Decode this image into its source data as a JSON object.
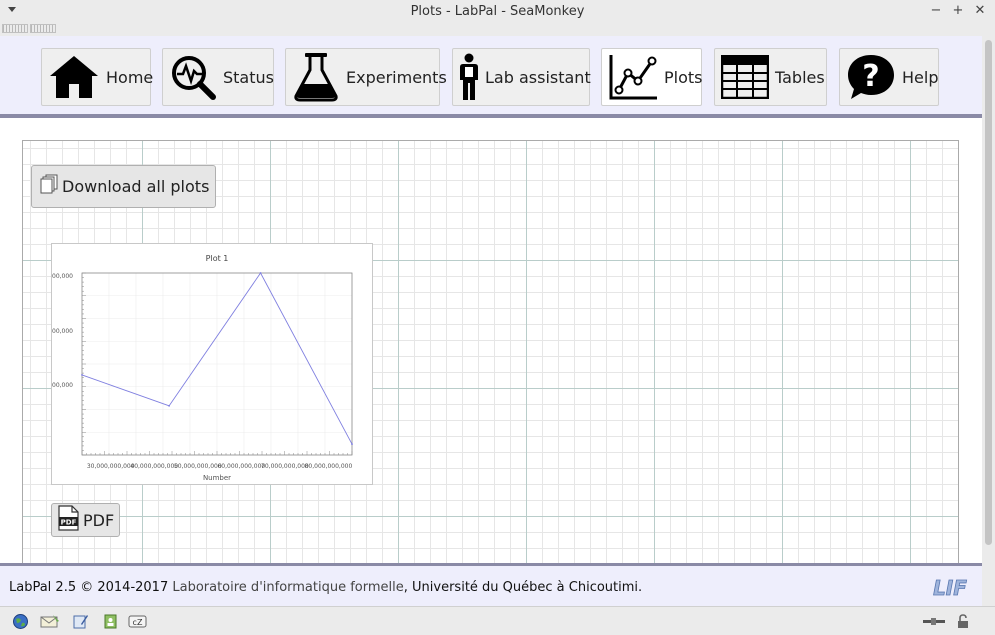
{
  "window": {
    "title": "Plots - LabPal - SeaMonkey",
    "buttons": [
      "minimize",
      "maximize",
      "close"
    ],
    "minimize_glyph": "−",
    "maximize_glyph": "+",
    "close_glyph": "✕"
  },
  "nav": {
    "items": [
      {
        "label": "Home",
        "icon": "home-icon"
      },
      {
        "label": "Status",
        "icon": "status-magnifier-icon"
      },
      {
        "label": "Experiments",
        "icon": "flask-icon"
      },
      {
        "label": "Lab assistant",
        "icon": "person-icon"
      },
      {
        "label": "Plots",
        "icon": "line-chart-icon",
        "active": true
      },
      {
        "label": "Tables",
        "icon": "table-icon"
      },
      {
        "label": "Help",
        "icon": "help-bubble-icon"
      }
    ]
  },
  "main": {
    "download_all_label": "Download all plots",
    "pdf_label": "PDF",
    "pdf_icon_text": "PDF"
  },
  "plot": {
    "title": "Plot 1",
    "xlabel": "Number",
    "x_ticks": [
      "30,000,000,000",
      "40,000,000,000",
      "50,000,000,000",
      "60,000,000,000",
      "70,000,000,000",
      "80,000,000,000"
    ],
    "y_ticks": [
      "00,000",
      "00,000",
      "00,000"
    ],
    "line_color": "#8080e0"
  },
  "chart_data": {
    "type": "line",
    "title": "Plot 1",
    "xlabel": "Number",
    "ylabel": "",
    "xlim": [
      28000000000,
      90000000000
    ],
    "ylim": [
      0,
      1
    ],
    "grid": true,
    "series": [
      {
        "x": [
          28000000000,
          48000000000,
          69000000000,
          90000000000
        ],
        "y": [
          0.44,
          0.27,
          1.0,
          0.06
        ]
      }
    ]
  },
  "footer": {
    "prefix": "LabPal 2.5 © 2014-2017 ",
    "lab_link": "Laboratoire d'informatique formelle",
    "suffix": ", Université du Québec à Chicoutimi.",
    "logo_text": "LIF"
  },
  "statusbar": {
    "left_icons": [
      "globe-icon",
      "mail-icon",
      "composer-icon",
      "addressbook-icon",
      "chatzilla-icon"
    ],
    "right_icons": [
      "connection-icon",
      "security-lock-icon"
    ]
  }
}
